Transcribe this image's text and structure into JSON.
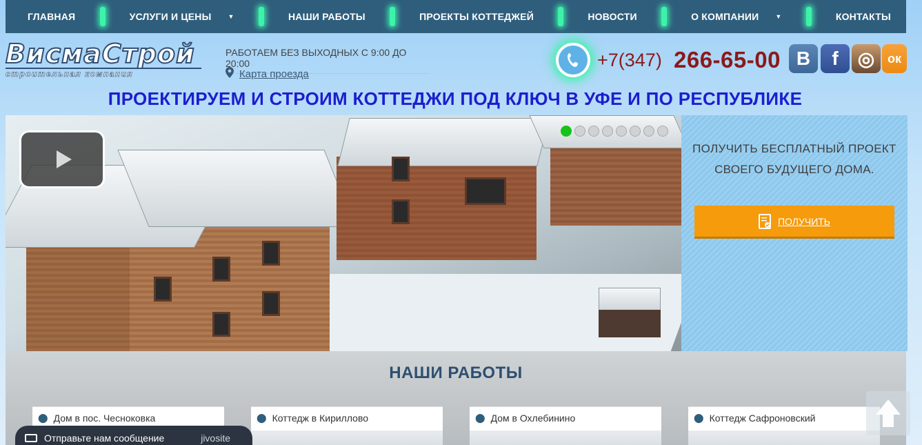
{
  "nav": {
    "items": [
      {
        "label": "ГЛАВНАЯ",
        "dropdown": false
      },
      {
        "label": "УСЛУГИ И ЦЕНЫ",
        "dropdown": true
      },
      {
        "label": "НАШИ РАБОТЫ",
        "dropdown": false
      },
      {
        "label": "ПРОЕКТЫ КОТТЕДЖЕЙ",
        "dropdown": false
      },
      {
        "label": "НОВОСТИ",
        "dropdown": false
      },
      {
        "label": "О КОМПАНИИ",
        "dropdown": true
      },
      {
        "label": "КОНТАКТЫ",
        "dropdown": false
      }
    ],
    "separator_color": "#3cf3a9",
    "background": "#2f5e7c"
  },
  "header": {
    "logo_main": "ВисмаСтрой",
    "logo_sub": "строительная компания",
    "hours": "РАБОТАЕМ БЕЗ ВЫХОДНЫХ С 9:00 ДО 20:00",
    "map_link": "Карта проезда",
    "phone_code": "+7(347)",
    "phone_number": "266-65-00",
    "social": [
      {
        "name": "vk-icon",
        "glyph": "В"
      },
      {
        "name": "facebook-icon",
        "glyph": "f"
      },
      {
        "name": "instagram-icon",
        "glyph": "◎"
      },
      {
        "name": "odnoklassniki-icon",
        "glyph": "ок"
      }
    ]
  },
  "headline": "ПРОЕКТИРУЕМ И СТРОИМ КОТТЕДЖИ ПОД КЛЮЧ В УФЕ И ПО РЕСПУБЛИКЕ",
  "slider": {
    "slide_count": 8,
    "active_index": 0
  },
  "promo": {
    "text_line1": "ПОЛУЧИТЬ БЕСПЛАТНЫЙ ПРОЕКТ",
    "text_line2": "СВОЕГО БУДУЩЕГО ДОМА.",
    "button": "ПОЛУЧИТЬ",
    "button_color": "#f59b0c"
  },
  "works": {
    "title": "НАШИ РАБОТЫ",
    "cards": [
      {
        "label": "Дом в пос. Чесноковка"
      },
      {
        "label": "Коттедж в Кириллово"
      },
      {
        "label": "Дом в Охлебинино"
      },
      {
        "label": "Коттедж Сафроновский"
      }
    ]
  },
  "chat": {
    "label": "Отправьте нам сообщение",
    "brand": "jivosite"
  },
  "accent_phone_color": "#8b1a1a",
  "headline_color": "#1c1ecf"
}
